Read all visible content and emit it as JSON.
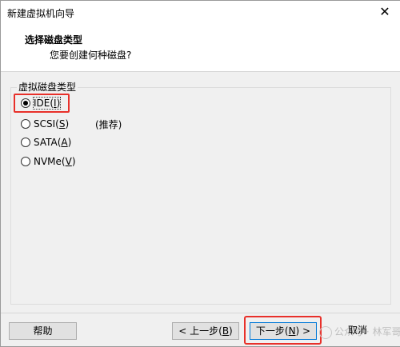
{
  "window": {
    "title": "新建虚拟机向导",
    "close_glyph": "✕"
  },
  "header": {
    "title": "选择磁盘类型",
    "subtitle": "您要创建何种磁盘?"
  },
  "group": {
    "label": "虚拟磁盘类型",
    "options": [
      {
        "pre": "IDE(",
        "key": "I",
        "post": ")",
        "checked": true
      },
      {
        "pre": "SCSI(",
        "key": "S",
        "post": ")",
        "checked": false
      },
      {
        "pre": "SATA(",
        "key": "A",
        "post": ")",
        "checked": false
      },
      {
        "pre": "NVMe(",
        "key": "V",
        "post": ")",
        "checked": false
      }
    ],
    "scsi_note": "(推荐)"
  },
  "footer": {
    "help": "帮助",
    "prev_pre": "< 上一步(",
    "prev_key": "B",
    "prev_post": ")",
    "next_pre": "下一步(",
    "next_key": "N",
    "next_post": ") >",
    "cancel": "取消"
  },
  "watermark": {
    "text": "公众号 · 林军哥"
  },
  "colors": {
    "highlight": "#e8302a",
    "accent": "#0078d7"
  }
}
